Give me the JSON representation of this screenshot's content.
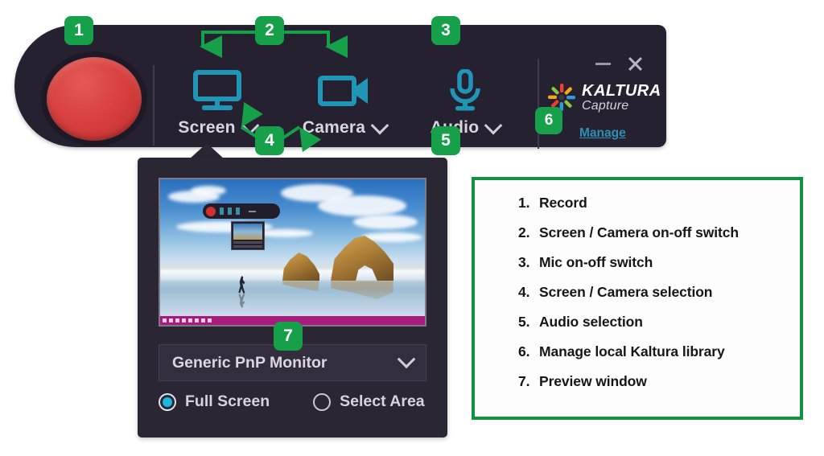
{
  "app": {
    "brand_name": "KALTURA",
    "brand_sub": "Capture",
    "manage_link": "Manage",
    "accent_teal": "#1f96b8",
    "accent_green": "#17a04a",
    "record_red": "#d8413f",
    "toolbar_bg": "#262130",
    "panel_bg": "#2b2634",
    "radio_blue": "#19b9e0"
  },
  "toolbar": {
    "record_button": "Record",
    "window_minimize": "minimize",
    "window_close": "close",
    "groups": [
      {
        "label": "Screen",
        "icon": "monitor-icon"
      },
      {
        "label": "Camera",
        "icon": "video-camera-icon"
      },
      {
        "label": "Audio",
        "icon": "microphone-icon"
      }
    ]
  },
  "panel": {
    "preview_title": "Preview window",
    "monitor": {
      "selected": "Generic PnP Monitor"
    },
    "capture_mode": {
      "options": [
        {
          "label": "Full Screen",
          "selected": true
        },
        {
          "label": "Select Area",
          "selected": false
        }
      ]
    }
  },
  "legend": {
    "items": [
      {
        "num": "1.",
        "text": "Record"
      },
      {
        "num": "2.",
        "text": "Screen / Camera on-off switch"
      },
      {
        "num": "3.",
        "text": "Mic on-off switch"
      },
      {
        "num": "4.",
        "text": "Screen / Camera selection"
      },
      {
        "num": "5.",
        "text": "Audio selection"
      },
      {
        "num": "6.",
        "text": "Manage local Kaltura library"
      },
      {
        "num": "7.",
        "text": "Preview window"
      }
    ]
  },
  "badges": {
    "b1": "1",
    "b2": "2",
    "b3": "3",
    "b4": "4",
    "b5": "5",
    "b6": "6",
    "b7": "7"
  }
}
